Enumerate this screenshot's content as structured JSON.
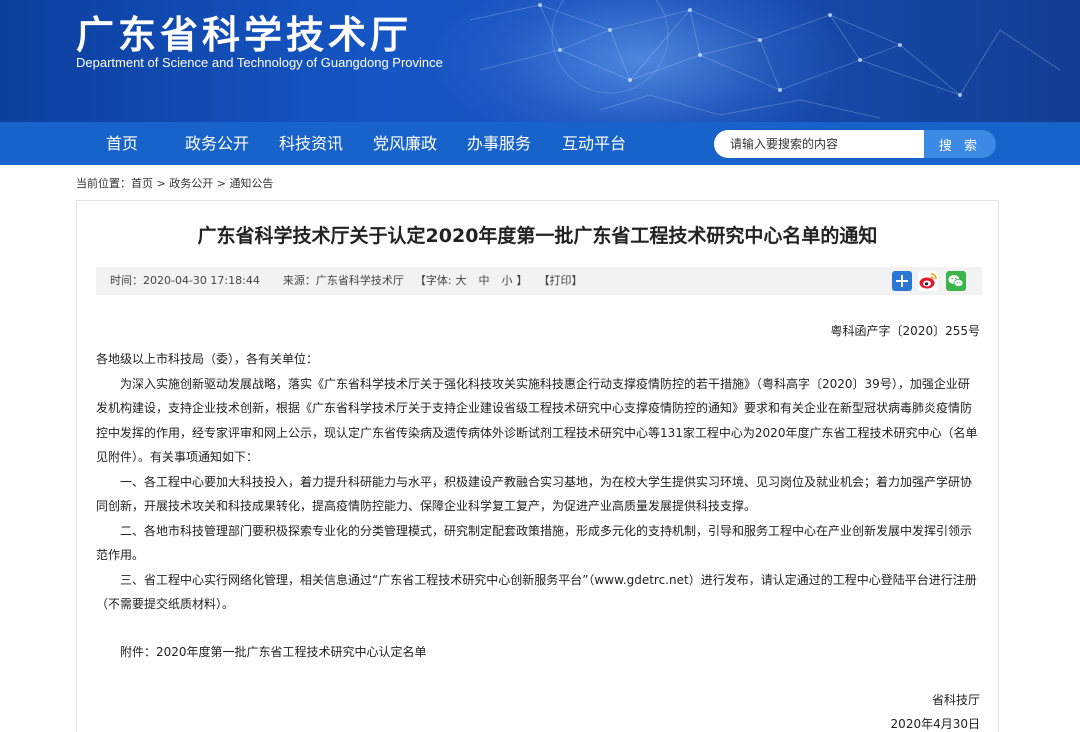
{
  "header": {
    "title_cn": "广东省科学技术厅",
    "title_en": "Department of Science and Technology of Guangdong Province"
  },
  "nav": {
    "items": [
      "首页",
      "政务公开",
      "科技资讯",
      "党风廉政",
      "办事服务",
      "互动平台"
    ]
  },
  "search": {
    "placeholder": "请输入要搜索的内容",
    "button": "搜 索"
  },
  "breadcrumb": {
    "prefix": "当前位置：",
    "items": [
      "首页",
      "政务公开",
      "通知公告"
    ],
    "sep": " > "
  },
  "article": {
    "title": "广东省科学技术厅关于认定2020年度第一批广东省工程技术研究中心名单的通知",
    "meta": {
      "time": "时间：2020-04-30 17:18:44",
      "source": "来源：广东省科学技术厅",
      "font_label": "【字体:",
      "font_large": "大",
      "font_medium": "中",
      "font_small": "小",
      "font_end": "】",
      "print": "【打印】"
    },
    "doc_number": "粤科函产字〔2020〕255号",
    "salutation": "各地级以上市科技局（委），各有关单位：",
    "paragraphs": [
      "为深入实施创新驱动发展战略，落实《广东省科学技术厅关于强化科技攻关实施科技惠企行动支撑疫情防控的若干措施》（粤科高字〔2020〕39号），加强企业研发机构建设，支持企业技术创新，根据《广东省科学技术厅关于支持企业建设省级工程技术研究中心支撑疫情防控的通知》要求和有关企业在新型冠状病毒肺炎疫情防控中发挥的作用，经专家评审和网上公示，现认定广东省传染病及遗传病体外诊断试剂工程技术研究中心等131家工程中心为2020年度广东省工程技术研究中心（名单见附件）。有关事项通知如下：",
      "一、各工程中心要加大科技投入，着力提升科研能力与水平，积极建设产教融合实习基地，为在校大学生提供实习环境、见习岗位及就业机会；着力加强产学研协同创新，开展技术攻关和科技成果转化，提高疫情防控能力、保障企业科学复工复产，为促进产业高质量发展提供科技支撑。",
      "二、各地市科技管理部门要积极探索专业化的分类管理模式，研究制定配套政策措施，形成多元化的支持机制，引导和服务工程中心在产业创新发展中发挥引领示范作用。",
      "三、省工程中心实行网络化管理，相关信息通过“广东省工程技术研究中心创新服务平台”（www.gdetrc.net）进行发布，请认定通过的工程中心登陆平台进行注册（不需要提交纸质材料）。"
    ],
    "attachment": "附件：2020年度第一批广东省工程技术研究中心认定名单",
    "sign_org": "省科技厅",
    "sign_date": "2020年4月30日"
  },
  "colors": {
    "nav_bg": "#1863c9",
    "search_button": "#3d8ae6",
    "banner_dark": "#0d3f9e"
  }
}
